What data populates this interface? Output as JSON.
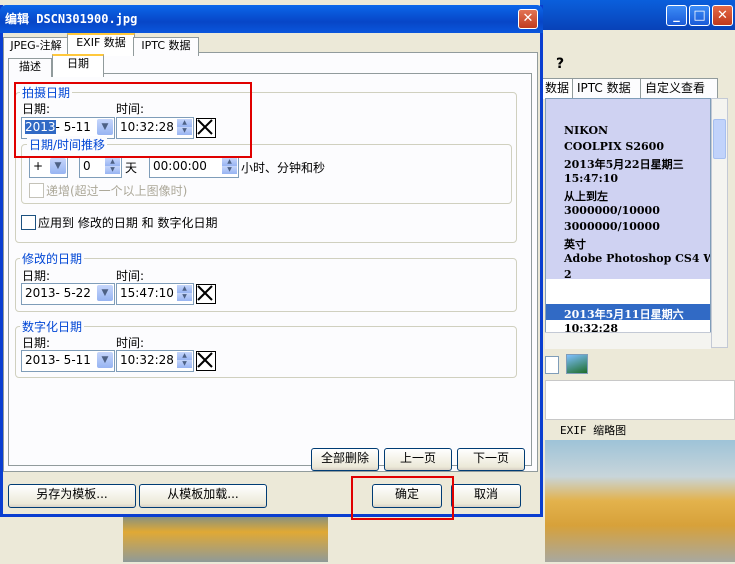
{
  "background_window": {
    "tabs": [
      "数据",
      "IPTC 数据",
      "自定义查看"
    ],
    "exif_lines": [
      "NIKON",
      "COOLPIX S2600",
      "2013年5月22日星期三",
      "15:47:10",
      "从上到左",
      "3000000/10000",
      "3000000/10000",
      "英寸",
      "Adobe Photoshop CS4 W",
      "2"
    ],
    "selected_lines": [
      "2013年5月11日星期六",
      "10:32:28"
    ],
    "bottom_label": "EXIF 缩略图",
    "menu_icon": "?"
  },
  "dialog": {
    "title": "编辑 DSCN301900.jpg",
    "close_glyph": "✕",
    "outer_tabs": [
      "JPEG-注解",
      "EXIF 数据",
      "IPTC 数据"
    ],
    "inner_tabs": [
      "描述",
      "日期"
    ],
    "shot_date": {
      "group_title": "拍摄日期",
      "date_label": "日期:",
      "time_label": "时间:",
      "date_year": "2013",
      "date_rest": "- 5-11",
      "time": "10:32:28"
    },
    "shift": {
      "group_title": "日期/时间推移",
      "sign": "+",
      "days": "0",
      "days_unit": "天",
      "time": "00:00:00",
      "time_unit": "小时、分钟和秒",
      "incremental": "递增(超过一个以上图像时)"
    },
    "apply_label": "应用到 修改的日期 和 数字化日期",
    "modified_date": {
      "group_title": "修改的日期",
      "date_label": "日期:",
      "time_label": "时间:",
      "date": "2013- 5-22",
      "time": "15:47:10"
    },
    "digitized_date": {
      "group_title": "数字化日期",
      "date_label": "日期:",
      "time_label": "时间:",
      "date": "2013- 5-11",
      "time": "10:32:28"
    },
    "buttons": {
      "delete_all": "全部删除",
      "prev": "上一页",
      "next": "下一页",
      "save_template": "另存为模板...",
      "load_template": "从模板加载...",
      "ok": "确定",
      "cancel": "取消"
    }
  },
  "colors": {
    "title_bar": "#0a56dd",
    "group_title": "#0046d5",
    "highlight_box": "#e00000",
    "selection": "#316ac5"
  }
}
